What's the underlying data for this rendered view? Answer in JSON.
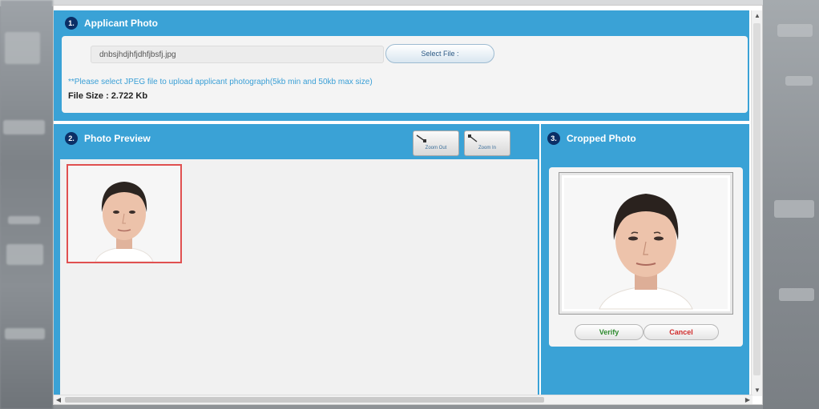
{
  "section1": {
    "number": "1.",
    "title": "Applicant Photo",
    "file_name": "dnbsjhdjhfjdhfjbsfj.jpg",
    "select_button": "Select File :",
    "hint": "**Please select JPEG file to upload applicant photograph(5kb min and 50kb max size)",
    "file_size": "File Size : 2.722 Kb"
  },
  "section2": {
    "number": "2.",
    "title": "Photo Preview",
    "zoom_out_label": "Zoom Out",
    "zoom_in_label": "Zoom In"
  },
  "section3": {
    "number": "3.",
    "title": "Cropped Photo",
    "verify_button": "Verify",
    "cancel_button": "Cancel"
  },
  "colors": {
    "panel_blue": "#3aa2d6",
    "badge_navy": "#0b2f66",
    "selection_red": "#e05050"
  },
  "icons": [
    "zoom-out-icon",
    "zoom-in-icon",
    "scroll-up-arrow-icon",
    "scroll-down-arrow-icon",
    "scroll-left-arrow-icon",
    "scroll-right-arrow-icon"
  ]
}
